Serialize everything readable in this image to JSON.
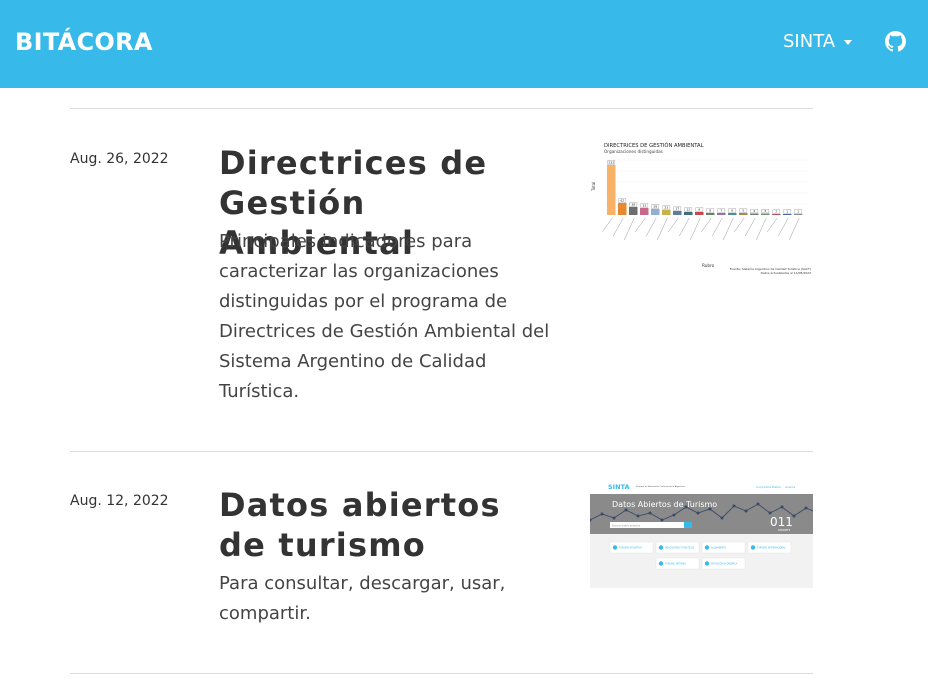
{
  "nav": {
    "brand": "BITÁCORA",
    "menu_label": "SINTA",
    "github_icon": "github-icon"
  },
  "posts": [
    {
      "date": "Aug. 26, 2022",
      "title": "Directrices de Gestión Ambiental",
      "description": "Principales indicadores para caracterizar las organizaciones distinguidas por el programa de Directrices de Gestión Ambiental del Sistema Argentino de Calidad Turística.",
      "thumbnail": {
        "title": "DIRECTRICES DE GESTIÓN AMBIENTAL",
        "subtitle": "Organizaciones distinguidas",
        "ylabel": "Total",
        "xlabel": "Rubro",
        "bar_labels": [
          "232",
          "62",
          "38",
          "33",
          "28",
          "23",
          "17",
          "12",
          "9",
          "8",
          "7",
          "6",
          "5",
          "4",
          "3",
          "2",
          "1",
          "1"
        ],
        "source": "Fuente: Sistema Argentino de Calidad Turística (SACT)",
        "updated": "Datos actualizados al 11/08/2022"
      }
    },
    {
      "date": "Aug. 12, 2022",
      "title": "Datos abiertos de turismo",
      "description": "Para consultar, descargar, usar, compartir.",
      "thumbnail": {
        "logo": "SINTA",
        "logo_sub": "Sistema de Información Turística de la Argentina",
        "nav_items": [
          "Conjuntos",
          "Datos",
          "Acerca"
        ],
        "hero_title": "Datos Abiertos de Turismo",
        "count": "011",
        "count_label": "DATASETS",
        "search_placeholder": "Buscar datos abiertos",
        "categories": [
          "TURISMO RECEPTIVO",
          "INDICADORES TURISTICOS",
          "ALOJAMIENTO",
          "TURISMO INTERNACIONAL",
          "TURISMO INTERNO",
          "SITUACION ECONOMICA"
        ]
      }
    }
  ],
  "colors": {
    "navbar": "#37b9ea",
    "text": "#333333",
    "divider": "#dcdcdc"
  }
}
